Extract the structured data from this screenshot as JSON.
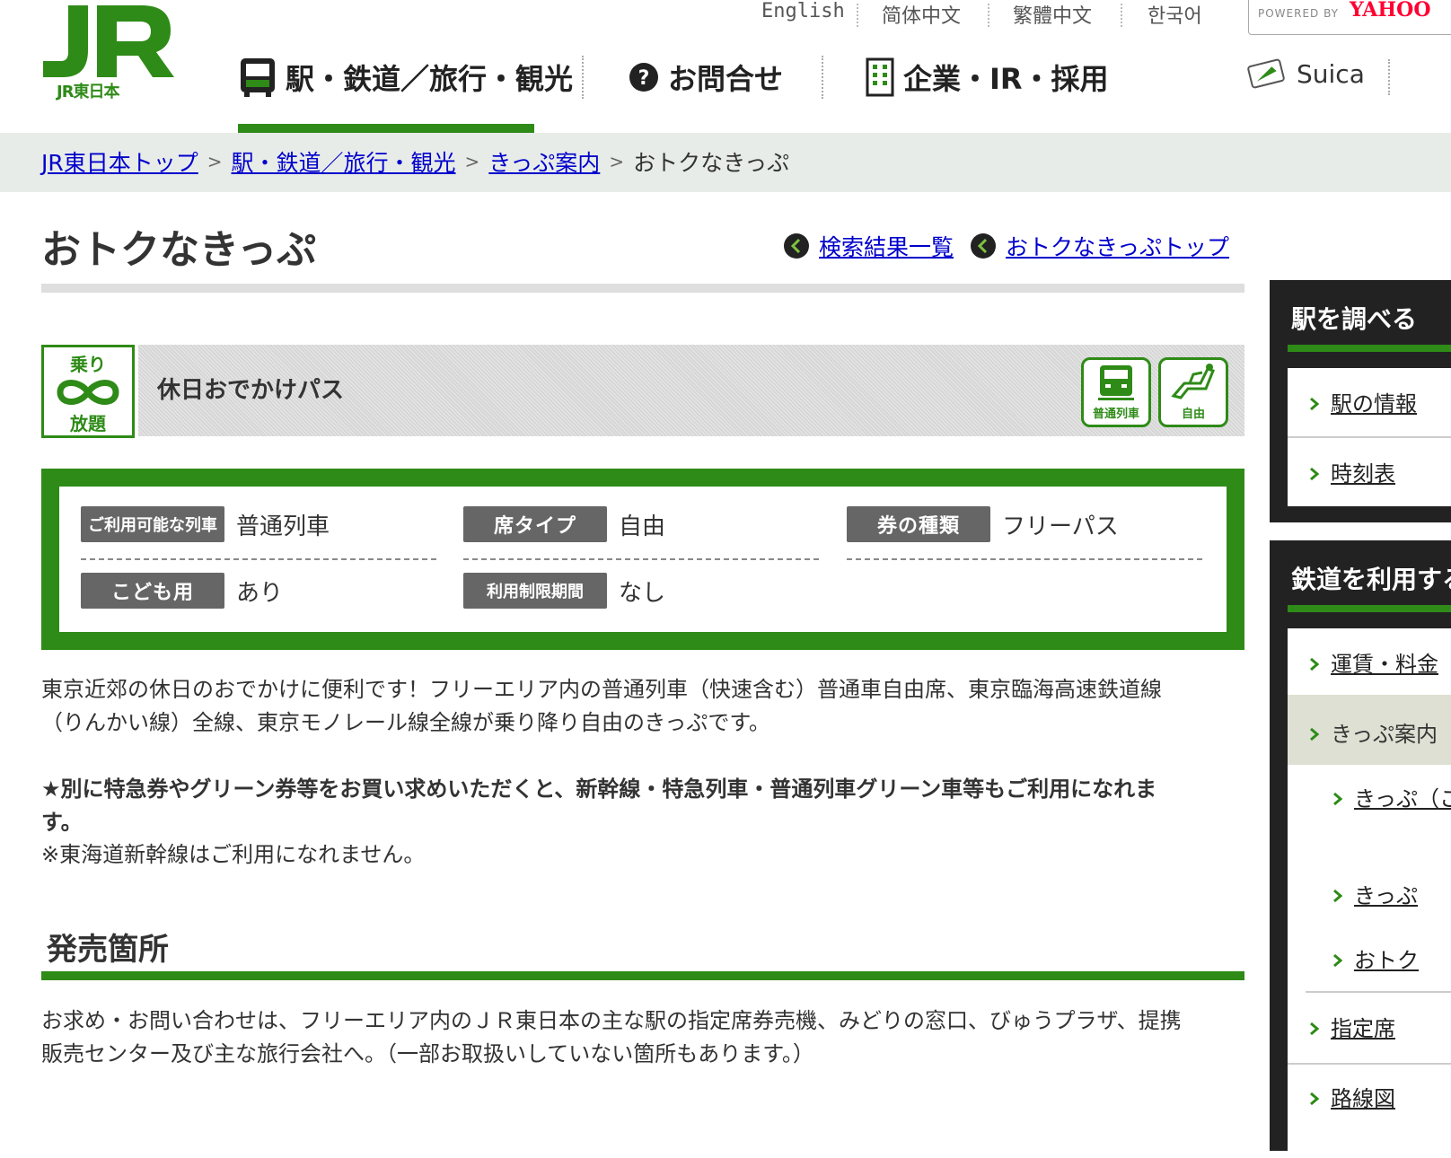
{
  "header": {
    "logo_text": "JR東日本",
    "languages": [
      "English",
      "简体中文",
      "繁體中文",
      "한국어"
    ],
    "yahoo": {
      "powered_by": "POWERED BY",
      "brand": "YAHOO"
    },
    "nav": [
      {
        "label": "駅・鉄道／旅行・観光",
        "icon": "train-icon",
        "active": true
      },
      {
        "label": "お問合せ",
        "icon": "question-icon"
      },
      {
        "label": "企業・IR・採用",
        "icon": "building-icon"
      }
    ],
    "suica_label": "Suica"
  },
  "breadcrumb": {
    "items": [
      "JR東日本トップ",
      "駅・鉄道／旅行・観光",
      "きっぷ案内"
    ],
    "current": "おトクなきっぷ",
    "separator": ">"
  },
  "page": {
    "title": "おトクなきっぷ",
    "links": [
      "検索結果一覧",
      "おトクなきっぷトップ"
    ]
  },
  "ticket": {
    "badge_text": [
      "乗り",
      "放題"
    ],
    "name": "休日おでかけパス",
    "icons": [
      {
        "name": "local-train-icon",
        "label": "普通列車"
      },
      {
        "name": "free-seat-icon",
        "label": "自由"
      }
    ],
    "info": [
      {
        "tag": "ご利用可能な列車",
        "value": "普通列車"
      },
      {
        "tag": "席タイプ",
        "value": "自由"
      },
      {
        "tag": "券の種類",
        "value": "フリーパス"
      },
      {
        "tag": "こども用",
        "value": "あり"
      },
      {
        "tag": "利用制限期間",
        "value": "なし"
      }
    ]
  },
  "content": {
    "desc1a": "東京近郊の休日のおでかけに便利です！フリーエリア内の普通列車（快速含む）普通車自由席、東京臨海高速鉄道線",
    "desc1b": "（りんかい線）全線、東京モノレール線全線が乗り降り自由のきっぷです。",
    "desc2a": "★別に特急券やグリーン券等をお買い求めいただくと、新幹線・特急列車・普通列車グリーン車等もご利用になれま",
    "desc2b": "す。",
    "note": "※東海道新幹線はご利用になれません。",
    "section_title": "発売箇所",
    "sales_a": "お求め・お問い合わせは、フリーエリア内のＪＲ東日本の主な駅の指定席券売機、みどりの窓口、びゅうプラザ、提携",
    "sales_b": "販売センター及び主な旅行会社へ。（一部お取扱いしていない箇所もあります。）"
  },
  "sidebar": {
    "box1": {
      "title": "駅を調べる",
      "items": [
        "駅の情報",
        "時刻表"
      ]
    },
    "box2": {
      "title": "鉄道を利用する",
      "items": [
        "運賃・料金",
        "きっぷ案内",
        "きっぷ（こと）",
        "きっぷ",
        "おトク",
        "指定席",
        "路線図"
      ],
      "highlight_index": 1
    }
  },
  "colors": {
    "brand_green": "#2e8b17",
    "link": "#0000cc",
    "tag_gray": "#666666"
  }
}
